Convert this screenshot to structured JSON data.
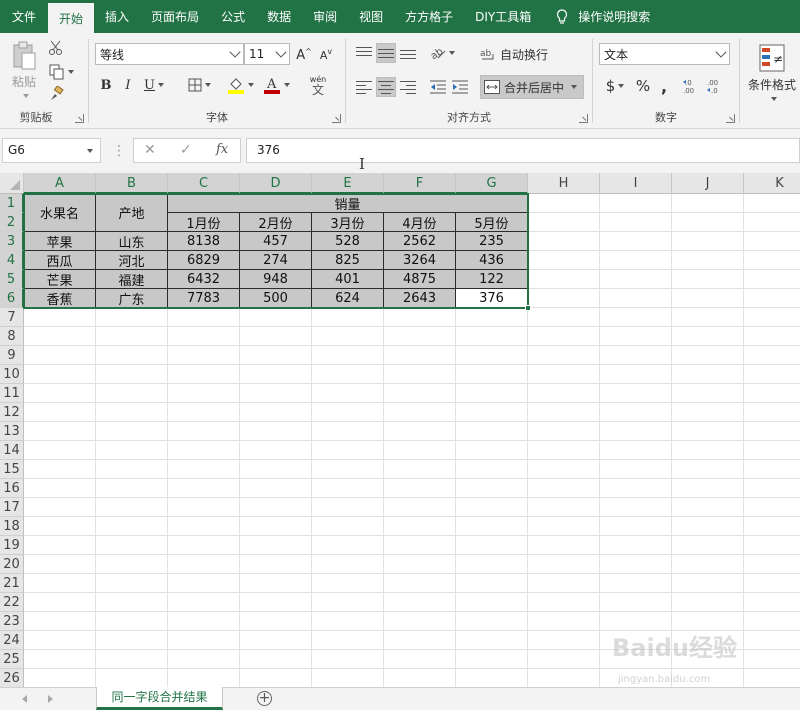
{
  "ribbon_tabs": [
    "文件",
    "开始",
    "插入",
    "页面布局",
    "公式",
    "数据",
    "审阅",
    "视图",
    "方方格子",
    "DIY工具箱"
  ],
  "search_label": "操作说明搜索",
  "clipboard": {
    "paste_label": "粘贴",
    "title": "剪贴板"
  },
  "font_group": {
    "font_name": "等线",
    "font_size": "11",
    "grow_glyph": "A",
    "shrink_glyph": "A",
    "bold": "B",
    "italic": "I",
    "underline": "U",
    "phonetic": "wén",
    "title": "字体"
  },
  "alignment": {
    "wrap_text_label": "自动换行",
    "merge_center_label": "合并后居中",
    "title": "对齐方式"
  },
  "number_group": {
    "format": "文本",
    "currency": "$",
    "percent": "%",
    "title": "数字"
  },
  "styles": {
    "conditional_label": "条件格式"
  },
  "formula_bar": {
    "cell_ref": "G6",
    "cancel": "✕",
    "enter": "✓",
    "fx": "fx",
    "value": "376",
    "dots": "⋮"
  },
  "columns": [
    "A",
    "B",
    "C",
    "D",
    "E",
    "F",
    "G",
    "H",
    "I",
    "J",
    "K"
  ],
  "rows": [
    "1",
    "2",
    "3",
    "4",
    "5",
    "6",
    "7",
    "8",
    "9",
    "10",
    "11",
    "12",
    "13",
    "14",
    "15",
    "16",
    "17",
    "18",
    "19",
    "20",
    "21",
    "22",
    "23",
    "24",
    "25",
    "26"
  ],
  "table": {
    "header_fruit": "水果名",
    "header_origin": "产地",
    "header_sales": "销量",
    "months": [
      "1月份",
      "2月份",
      "3月份",
      "4月份",
      "5月份"
    ],
    "rows": [
      {
        "fruit": "苹果",
        "origin": "山东",
        "values": [
          "8138",
          "457",
          "528",
          "2562",
          "235"
        ]
      },
      {
        "fruit": "西瓜",
        "origin": "河北",
        "values": [
          "6829",
          "274",
          "825",
          "3264",
          "436"
        ]
      },
      {
        "fruit": "芒果",
        "origin": "福建",
        "values": [
          "6432",
          "948",
          "401",
          "4875",
          "122"
        ]
      },
      {
        "fruit": "香蕉",
        "origin": "广东",
        "values": [
          "7783",
          "500",
          "624",
          "2643",
          "376"
        ]
      }
    ]
  },
  "sheet_tab": "同一字段合并结果",
  "add_sheet": "+",
  "watermark": "Baidu经验",
  "watermark_url": "jingyan.baidu.com",
  "colors": {
    "excel_green": "#217346",
    "cell_gray": "#c8c8c8"
  }
}
